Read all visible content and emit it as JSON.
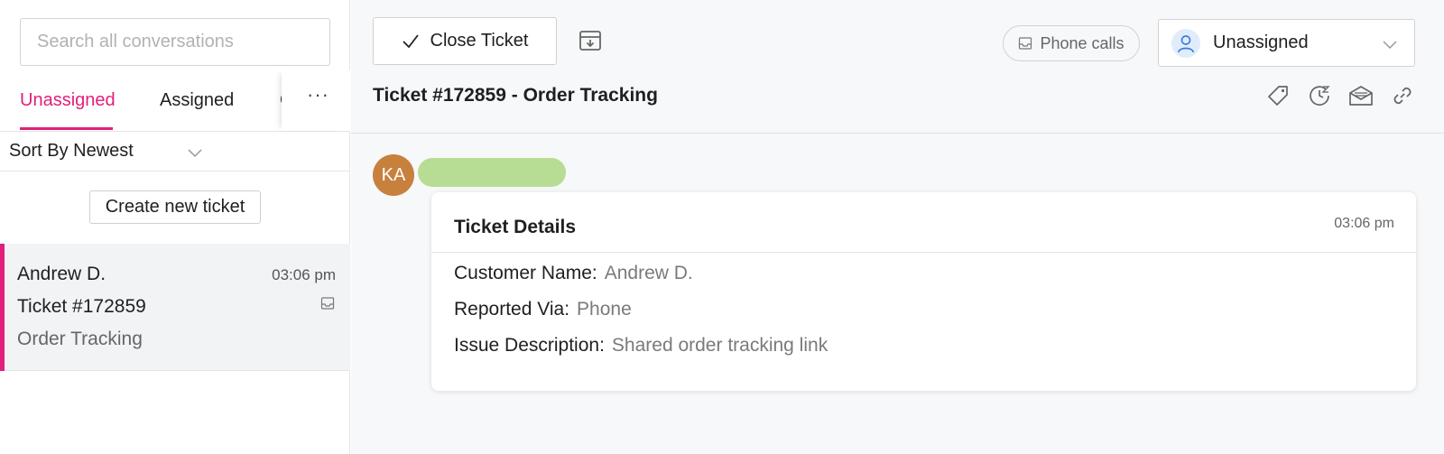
{
  "sidebar": {
    "search_placeholder": "Search all conversations",
    "tabs": [
      {
        "label": "Unassigned",
        "active": true
      },
      {
        "label": "Assigned",
        "active": false
      },
      {
        "label": "C",
        "active": false
      }
    ],
    "more_label": "···",
    "sort_label": "Sort By Newest",
    "create_label": "Create new ticket",
    "conversation": {
      "name": "Andrew D.",
      "time": "03:06 pm",
      "ticket": "Ticket #172859",
      "subject": "Order Tracking",
      "channel_icon": "inbox-icon"
    }
  },
  "toolbar": {
    "close_label": "Close Ticket",
    "archive_icon": "archive-icon",
    "channel_label": "Phone calls",
    "assignee_label": "Unassigned"
  },
  "ticket": {
    "title": "Ticket #172859 - Order Tracking",
    "tools": [
      "tag-icon",
      "snooze-icon",
      "email-icon",
      "link-icon"
    ]
  },
  "message": {
    "avatar_initials": "KA",
    "card_title": "Ticket Details",
    "card_time": "03:06 pm",
    "fields": [
      {
        "label": "Customer Name:",
        "value": "Andrew D."
      },
      {
        "label": "Reported Via:",
        "value": "Phone"
      },
      {
        "label": "Issue Description:",
        "value": "Shared order tracking link"
      }
    ]
  },
  "colors": {
    "accent": "#e0207a",
    "avatar": "#c8803d",
    "name_redaction": "#b7dc94"
  }
}
